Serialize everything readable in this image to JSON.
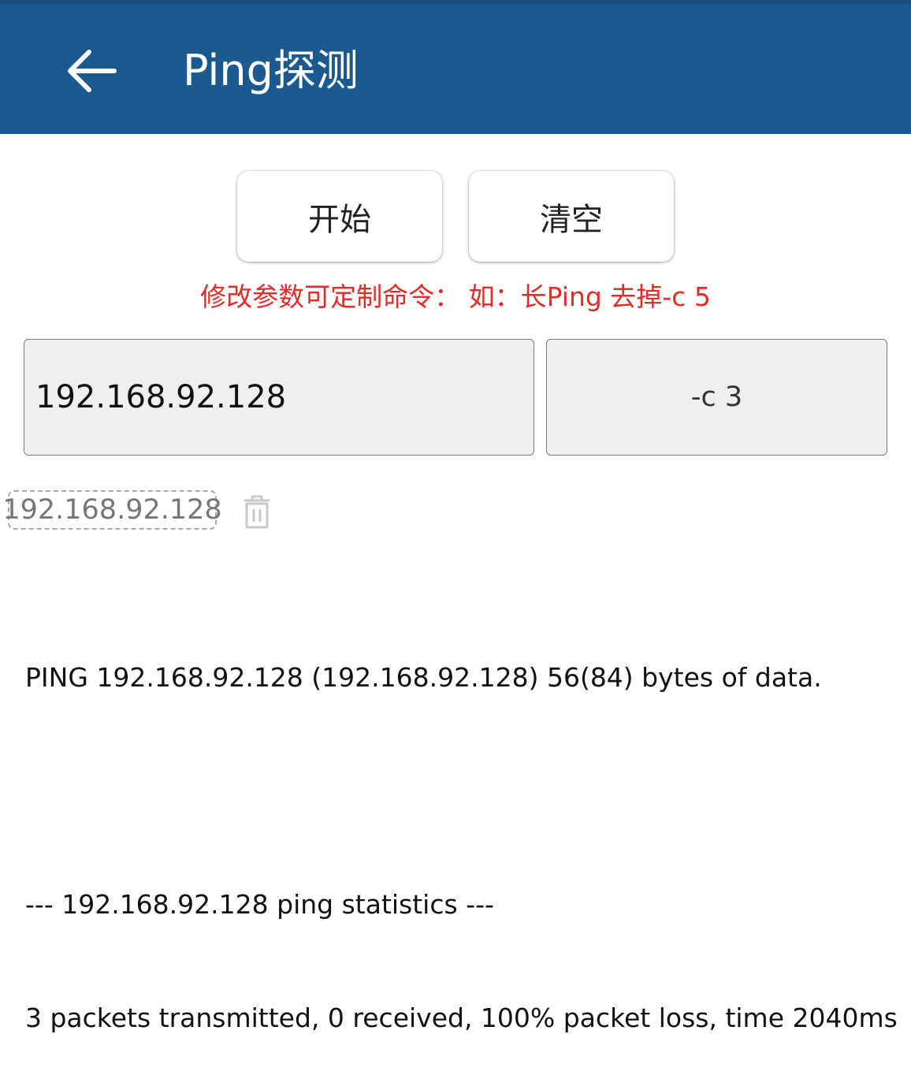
{
  "appbar": {
    "title": "Ping探测",
    "back_icon": "arrow-left-icon",
    "color": "#1b5a8f"
  },
  "buttons": {
    "start_label": "开始",
    "clear_label": "清空"
  },
  "hint": {
    "text": "修改参数可定制命令： 如：长Ping 去掉-c 5",
    "color": "#e62a26"
  },
  "inputs": {
    "host_value": "192.168.92.128",
    "param_value": "-c 3"
  },
  "history": {
    "items": [
      "192.168.92.128"
    ],
    "delete_icon": "trash-icon"
  },
  "output": {
    "lines": [
      "PING 192.168.92.128 (192.168.92.128) 56(84) bytes of data.",
      "",
      "--- 192.168.92.128 ping statistics ---",
      "3 packets transmitted, 0 received, 100% packet loss, time 2040ms"
    ]
  }
}
